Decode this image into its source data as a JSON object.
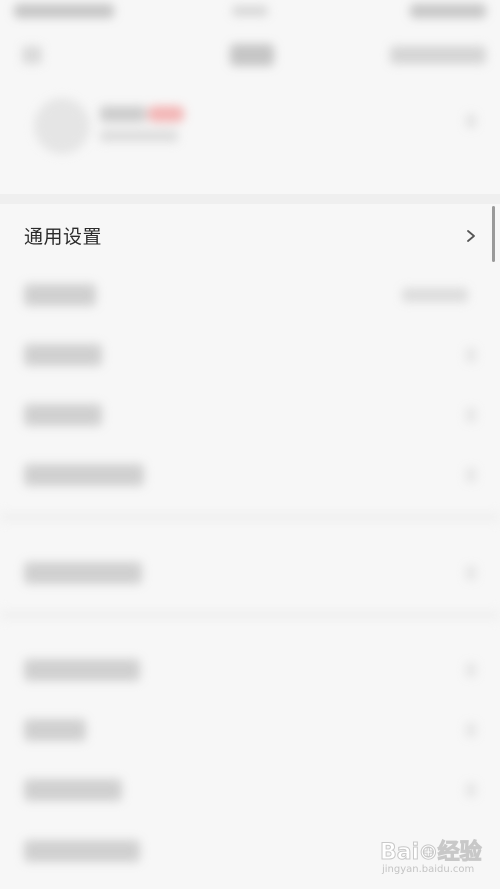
{
  "settings": {
    "general_settings_label": "通用设置"
  },
  "icons": {
    "chevron": "chevron-right-icon"
  },
  "colors": {
    "background": "#f7f7f7",
    "text_primary": "#2b2b2b",
    "chevron": "#555555",
    "badge": "#f2a9a9"
  },
  "watermark": {
    "logo_text": "Bai⊕经验",
    "url_text": "jingyan.baidu.com"
  }
}
